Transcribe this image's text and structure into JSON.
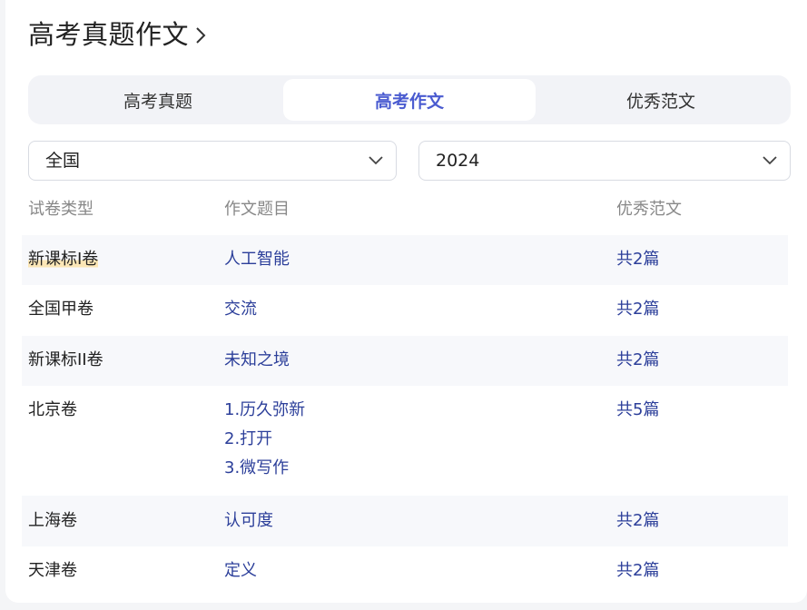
{
  "header": {
    "title": "高考真题作文"
  },
  "tabs": [
    {
      "label": "高考真题"
    },
    {
      "label": "高考作文"
    },
    {
      "label": "优秀范文"
    }
  ],
  "filters": {
    "region": "全国",
    "year": "2024"
  },
  "table": {
    "headers": [
      "试卷类型",
      "作文题目",
      "优秀范文"
    ],
    "rows": [
      {
        "type": "新课标I卷",
        "topics": [
          "人工智能"
        ],
        "essays": "共2篇"
      },
      {
        "type": "全国甲卷",
        "topics": [
          "交流"
        ],
        "essays": "共2篇"
      },
      {
        "type": "新课标II卷",
        "topics": [
          "未知之境"
        ],
        "essays": "共2篇"
      },
      {
        "type": "北京卷",
        "topics": [
          "1.历久弥新",
          "2.打开",
          "3.微写作"
        ],
        "essays": "共5篇"
      },
      {
        "type": "上海卷",
        "topics": [
          "认可度"
        ],
        "essays": "共2篇"
      },
      {
        "type": "天津卷",
        "topics": [
          "定义"
        ],
        "essays": "共2篇"
      }
    ]
  },
  "colors": {
    "accent": "#4a5bd0",
    "link": "#2c3f9a",
    "row_shade": "#f7f8fb",
    "highlight": "#fbe6b6"
  }
}
